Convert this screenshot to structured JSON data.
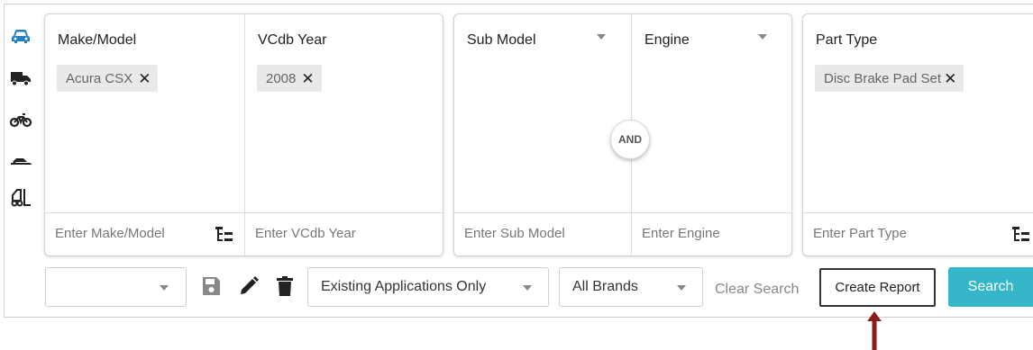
{
  "colors": {
    "accent": "#35b7c9",
    "car_icon": "#1f7fc1",
    "arrow": "#8b1c1c"
  },
  "vehicle_types": [
    "car-icon",
    "truck-icon",
    "motorcycle-icon",
    "snowmobile-icon",
    "forklift-icon"
  ],
  "filters": {
    "make_model": {
      "title": "Make/Model",
      "chip": "Acura CSX",
      "placeholder": "Enter Make/Model"
    },
    "vcdb_year": {
      "title": "VCdb Year",
      "chip": "2008",
      "placeholder": "Enter VCdb Year"
    },
    "sub_model": {
      "title": "Sub Model",
      "placeholder": "Enter Sub Model"
    },
    "engine": {
      "title": "Engine",
      "placeholder": "Enter Engine"
    },
    "part_type": {
      "title": "Part Type",
      "chip": "Disc Brake Pad Set",
      "placeholder": "Enter Part Type"
    },
    "and_label": "AND",
    "chip_remove": "✕"
  },
  "toolbar": {
    "saved_search_value": "",
    "applications_select": "Existing Applications Only",
    "brands_select": "All Brands",
    "clear_label": "Clear Search",
    "create_report_label": "Create Report",
    "search_label": "Search"
  }
}
